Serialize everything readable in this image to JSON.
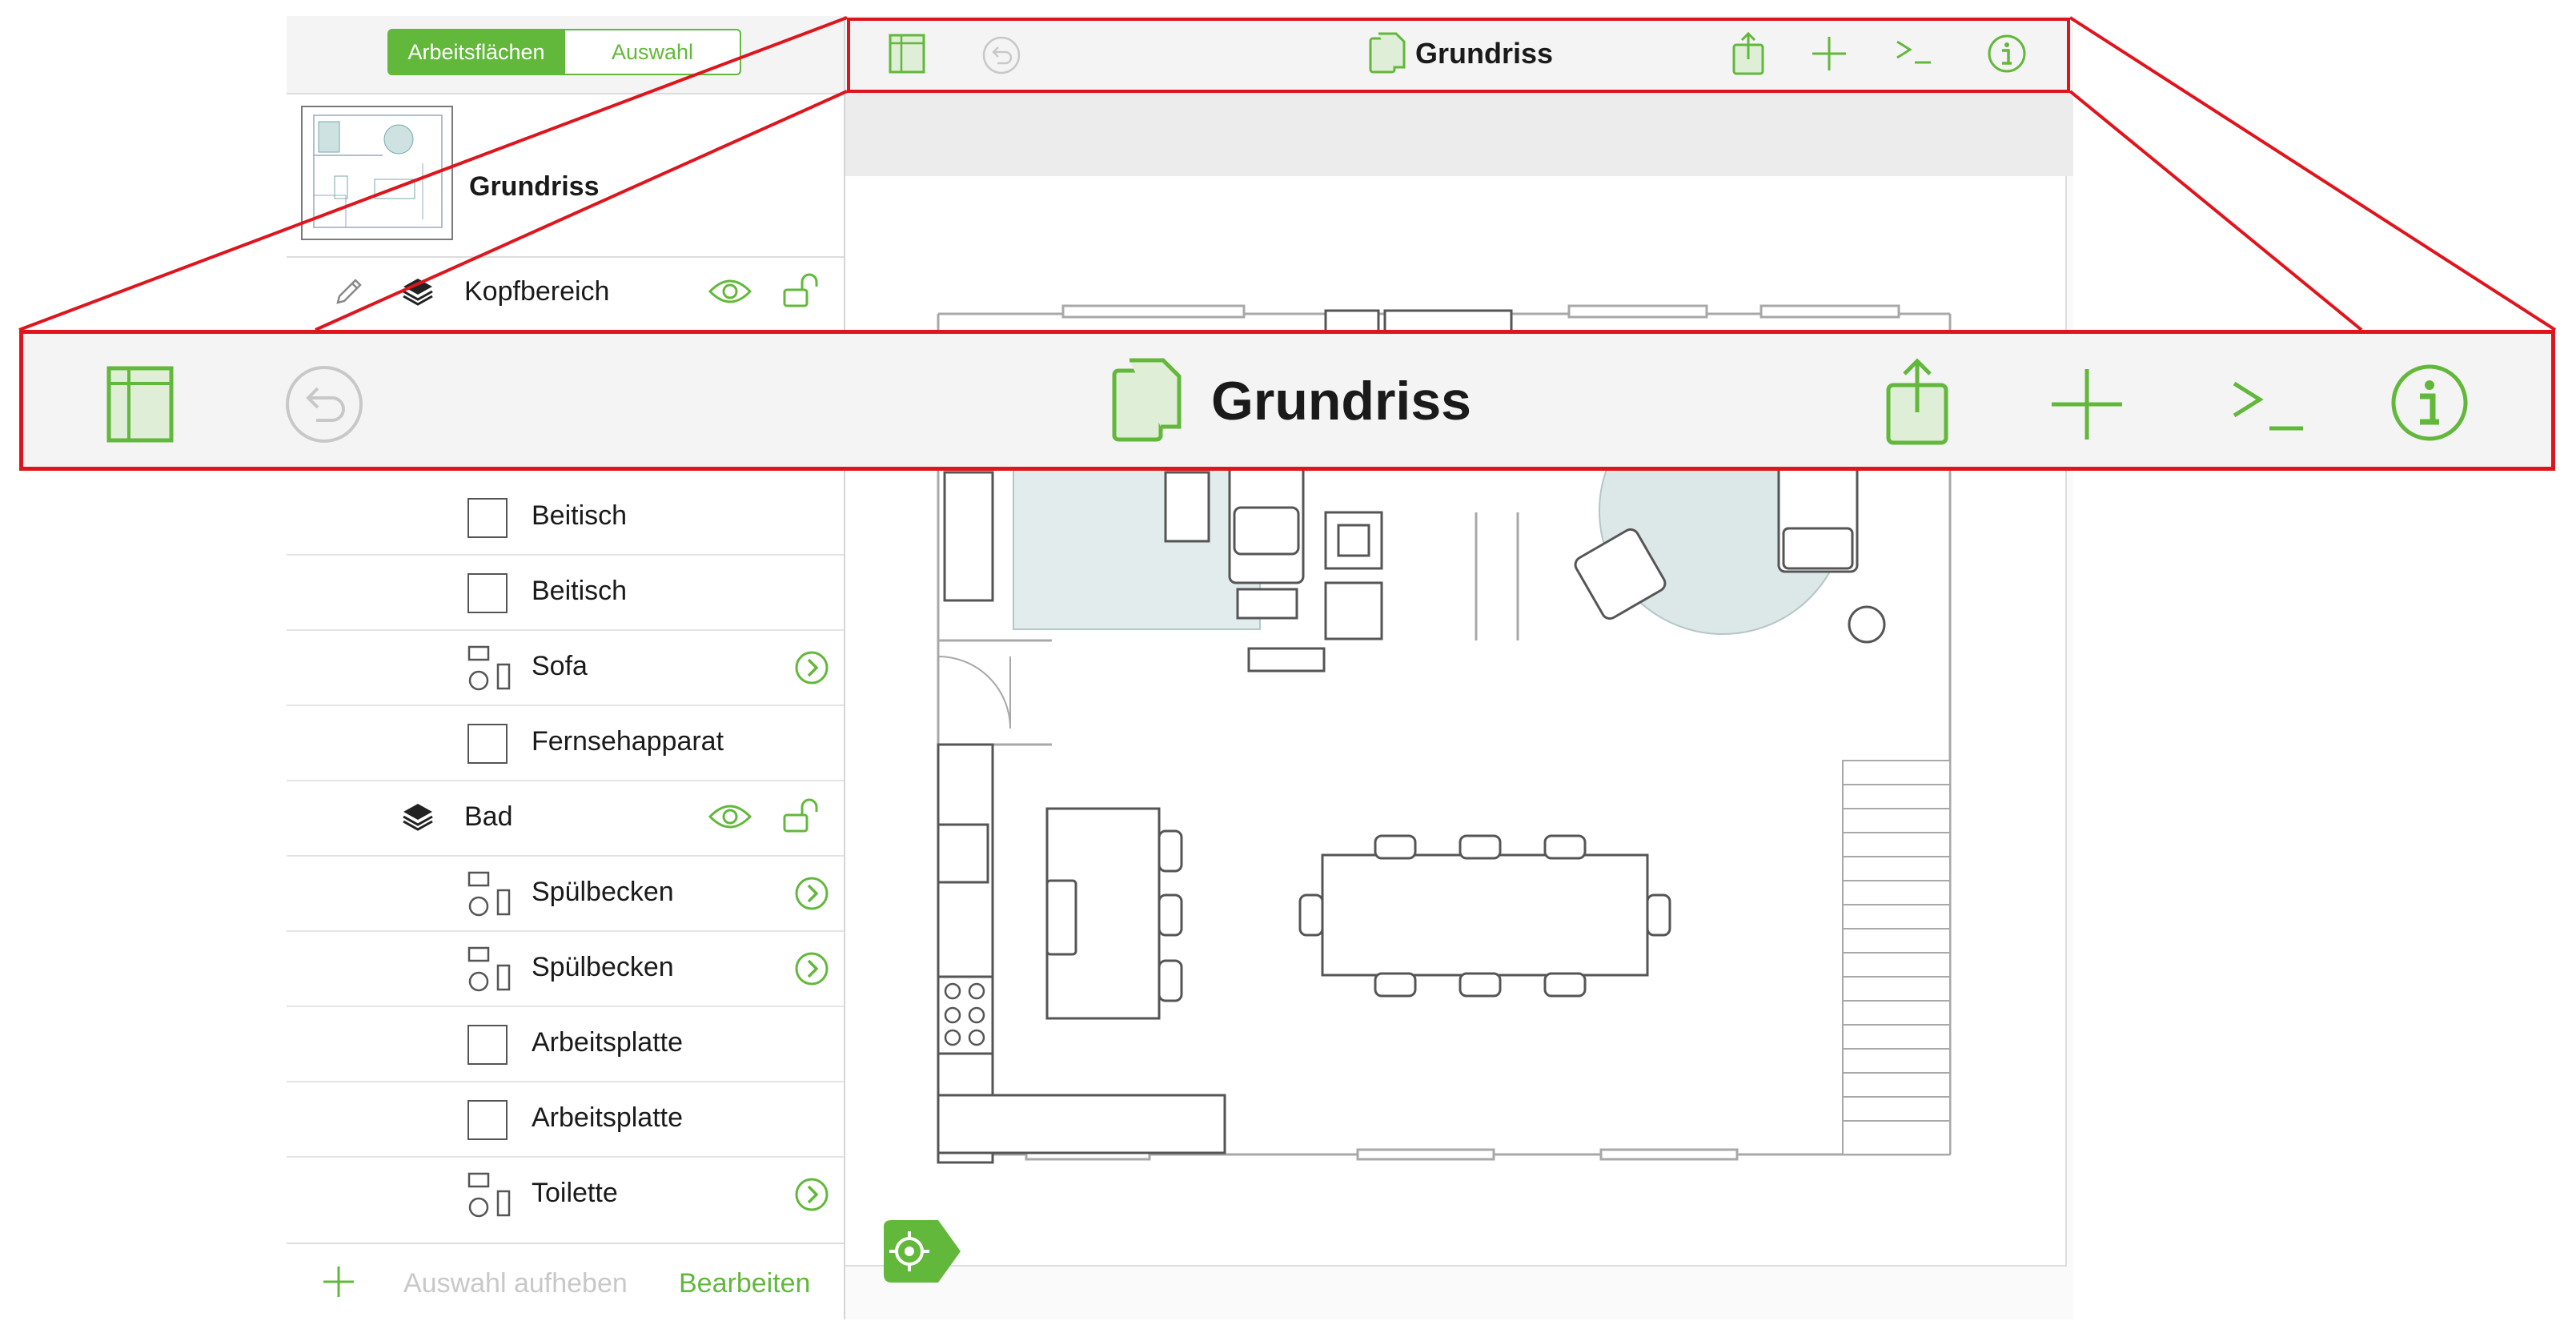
{
  "colors": {
    "accent": "#62b83a",
    "callout": "#e0141c",
    "disabled": "#c8c8c8"
  },
  "sidebar": {
    "segments": [
      "Arbeitsflächen",
      "Auswahl"
    ],
    "canvas_title": "Grundriss",
    "header_layer": {
      "label": "Kopfbereich",
      "icons": [
        "pencil-icon",
        "layer-stack-icon",
        "eye-icon",
        "lock-open-icon"
      ]
    },
    "items": [
      {
        "label": "Beitisch",
        "type": "shape"
      },
      {
        "label": "Beitisch",
        "type": "shape"
      },
      {
        "label": "Sofa",
        "type": "group"
      },
      {
        "label": "Fernsehapparat",
        "type": "shape"
      },
      {
        "label": "Bad",
        "type": "layer"
      },
      {
        "label": "Spülbecken",
        "type": "group"
      },
      {
        "label": "Spülbecken",
        "type": "group"
      },
      {
        "label": "Arbeitsplatte",
        "type": "shape"
      },
      {
        "label": "Arbeitsplatte",
        "type": "shape"
      },
      {
        "label": "Toilette",
        "type": "group"
      }
    ],
    "bottom": {
      "add_icon": "plus-icon",
      "deselect": "Auswahl aufheben",
      "edit": "Bearbeiten"
    }
  },
  "toolbar": {
    "title": "Grundriss",
    "icons": [
      "sidebar-icon",
      "undo-icon",
      "document-icon",
      "share-icon",
      "plus-icon",
      "console-icon",
      "info-icon"
    ]
  },
  "callout": {
    "title": "Grundriss"
  }
}
